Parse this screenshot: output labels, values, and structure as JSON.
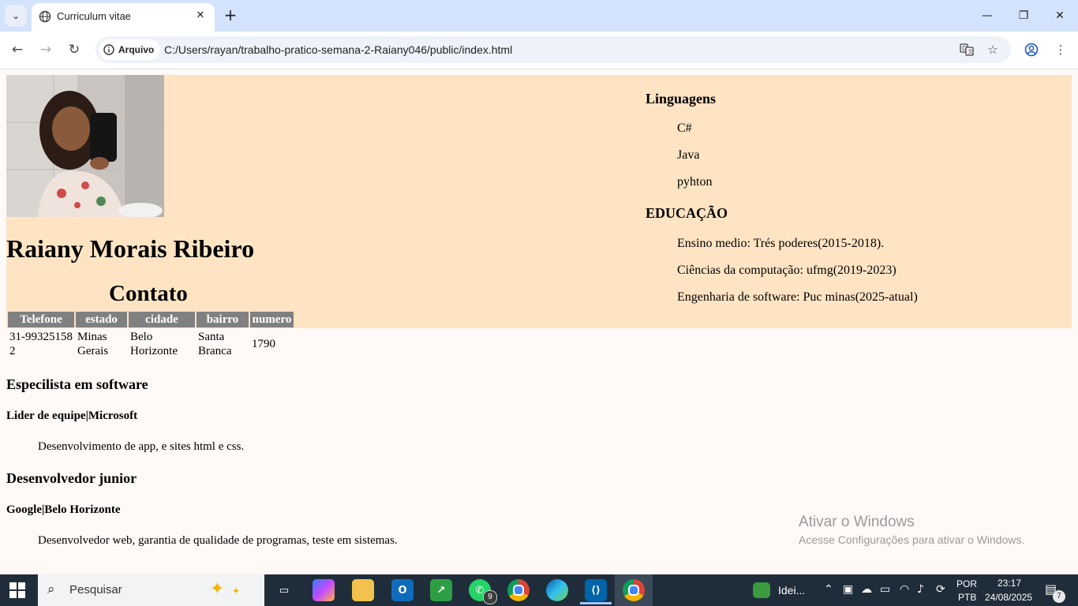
{
  "browser": {
    "tab_title": "Curriculum vitae",
    "close_tab_label": "✕",
    "new_tab_label": "+",
    "security_chip": "Arquivo",
    "url": "C:/Users/rayan/trabalho-pratico-semana-2-Raiany046/public/index.html",
    "icons": [
      "tab-list-icon",
      "globe-icon",
      "back-arrow-icon",
      "forward-arrow-icon",
      "reload-icon",
      "info-icon",
      "translate-icon",
      "star-icon",
      "profile-icon",
      "menu-dots-icon",
      "minimize-icon",
      "restore-icon",
      "close-icon"
    ]
  },
  "page": {
    "name": "Raiany Morais Ribeiro",
    "contact_heading": "Contato",
    "contact_table": {
      "headers": [
        "Telefone",
        "estado",
        "cidade",
        "bairro",
        "numero"
      ],
      "row": [
        "31-993251582",
        "Minas Gerais",
        "Belo Horizonte",
        "Santa Branca",
        "1790"
      ]
    },
    "languages": {
      "heading": "Linguagens",
      "items": [
        "C#",
        "Java",
        "pyhton"
      ]
    },
    "education": {
      "heading": "EDUCAÇÃO",
      "items": [
        "Ensino medio: Trés poderes(2015-2018).",
        "Ciências da computação: ufmg(2019-2023)",
        "Engenharia de software: Puc minas(2025-atual)"
      ]
    },
    "experience": [
      {
        "title": "Especilista em software",
        "company": "Lider de equipe|Microsoft",
        "description": "Desenvolvimento de app, e sites html e css."
      },
      {
        "title": "Desenvolvedor junior",
        "company": "Google|Belo Horizonte",
        "description": "Desenvolvedor web, garantia de qualidade de programas, teste em sistemas."
      }
    ],
    "header_background": "#ffe4c4",
    "table_header_background": "#808080"
  },
  "watermark": {
    "title": "Ativar o Windows",
    "subtitle": "Acesse Configurações para ativar o Windows."
  },
  "taskbar": {
    "search_placeholder": "Pesquisar",
    "whatsapp_badge": "9",
    "widget_label": "Idei...",
    "language_top": "POR",
    "language_bottom": "PTB",
    "time": "23:17",
    "date": "24/08/2025",
    "notifications_count": "7",
    "apps": [
      "task-view",
      "copilot",
      "file-explorer",
      "outlook",
      "stocks",
      "whatsapp",
      "chrome",
      "edge",
      "vscode",
      "chrome-active"
    ]
  }
}
